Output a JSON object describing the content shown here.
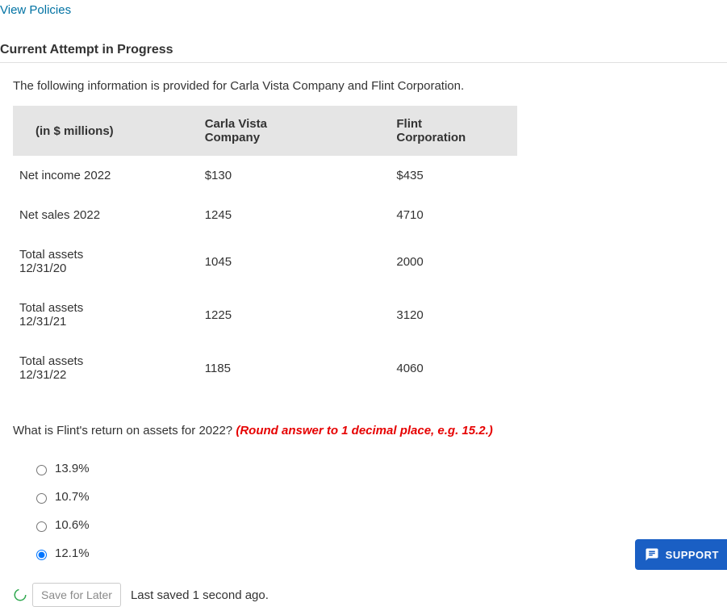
{
  "header": {
    "viewPolicies": "View Policies",
    "attemptTitle": "Current Attempt in Progress"
  },
  "intro": "The following information is provided for Carla Vista Company and Flint Corporation.",
  "table": {
    "headers": [
      "(in $ millions)",
      "Carla Vista Company",
      "Flint Corporation"
    ],
    "rows": [
      {
        "label": "Net income 2022",
        "a": "$130",
        "b": "$435"
      },
      {
        "label": "Net sales 2022",
        "a": "1245",
        "b": "4710"
      },
      {
        "label": "Total assets 12/31/20",
        "a": "1045",
        "b": "2000"
      },
      {
        "label": "Total assets 12/31/21",
        "a": "1225",
        "b": "3120"
      },
      {
        "label": "Total assets 12/31/22",
        "a": "1185",
        "b": "4060"
      }
    ]
  },
  "question": {
    "text": "What is Flint's return on assets for 2022? ",
    "hint": "(Round answer to 1 decimal place, e.g. 15.2.)"
  },
  "options": [
    {
      "label": "13.9%",
      "selected": false
    },
    {
      "label": "10.7%",
      "selected": false
    },
    {
      "label": "10.6%",
      "selected": false
    },
    {
      "label": "12.1%",
      "selected": true
    }
  ],
  "footer": {
    "saveLabel": "Save for Later",
    "savedStatus": "Last saved 1 second ago."
  },
  "support": {
    "label": "SUPPORT"
  }
}
